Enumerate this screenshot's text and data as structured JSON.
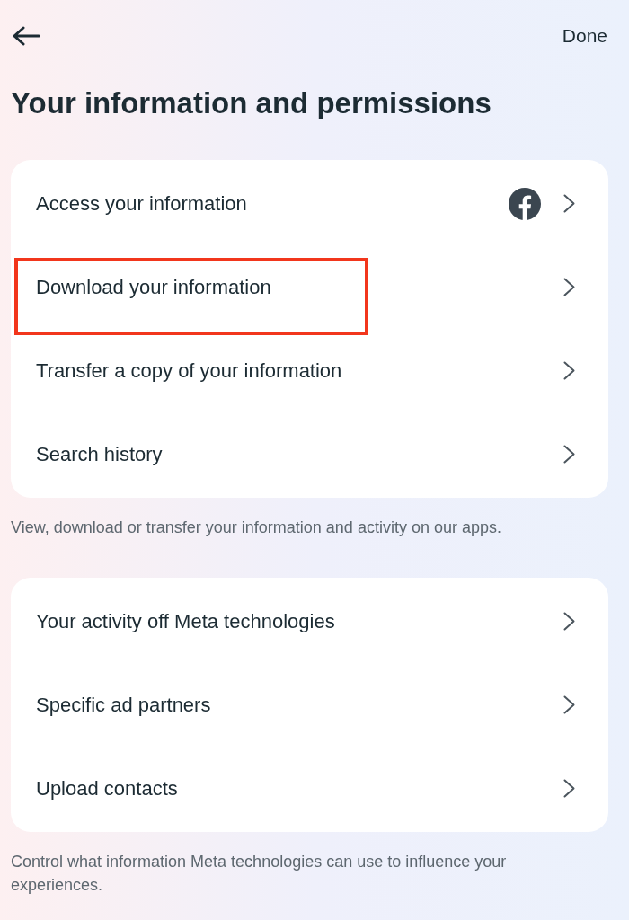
{
  "header": {
    "done_label": "Done"
  },
  "title": "Your information and permissions",
  "sections": [
    {
      "items": [
        {
          "label": "Access your information",
          "kind": "app-icon",
          "highlighted": false
        },
        {
          "label": "Download your information",
          "kind": "plain",
          "highlighted": true
        },
        {
          "label": "Transfer a copy of your information",
          "kind": "plain",
          "highlighted": false
        },
        {
          "label": "Search history",
          "kind": "plain",
          "highlighted": false
        }
      ],
      "footnote": "View, download or transfer your information and activity on our apps."
    },
    {
      "items": [
        {
          "label": "Your activity off Meta technologies",
          "kind": "plain",
          "highlighted": false
        },
        {
          "label": "Specific ad partners",
          "kind": "plain",
          "highlighted": false
        },
        {
          "label": "Upload contacts",
          "kind": "plain",
          "highlighted": false
        }
      ],
      "footnote": "Control what information Meta technologies can use to influence your experiences."
    }
  ]
}
